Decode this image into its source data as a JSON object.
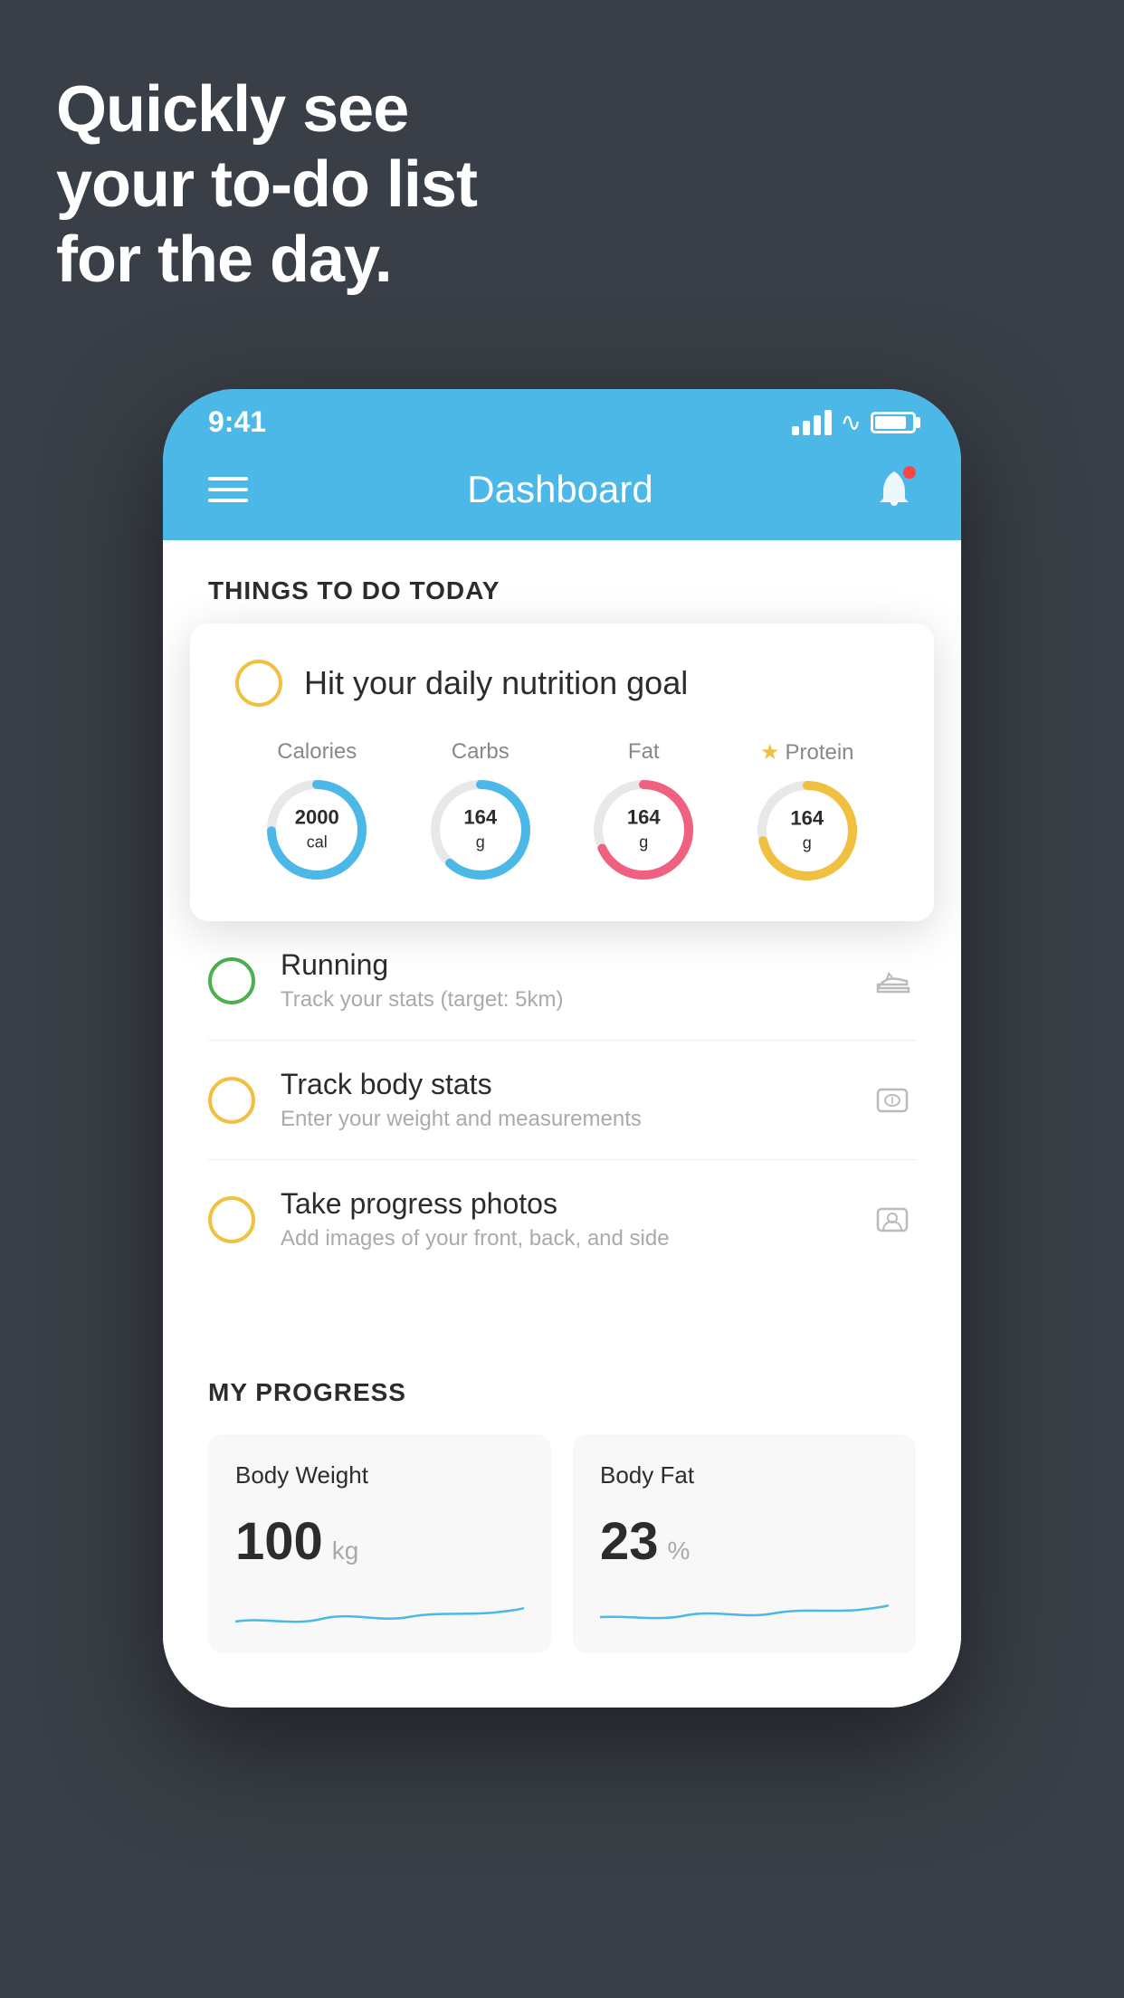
{
  "headline": {
    "line1": "Quickly see",
    "line2": "your to-do list",
    "line3": "for the day."
  },
  "status_bar": {
    "time": "9:41"
  },
  "header": {
    "title": "Dashboard"
  },
  "things_section": {
    "heading": "THINGS TO DO TODAY"
  },
  "featured_card": {
    "title": "Hit your daily nutrition goal",
    "nutrition": {
      "calories": {
        "label": "Calories",
        "value": "2000",
        "unit": "cal",
        "color": "#4bb8e8"
      },
      "carbs": {
        "label": "Carbs",
        "value": "164",
        "unit": "g",
        "color": "#4bb8e8"
      },
      "fat": {
        "label": "Fat",
        "value": "164",
        "unit": "g",
        "color": "#f06080"
      },
      "protein": {
        "label": "Protein",
        "value": "164",
        "unit": "g",
        "color": "#f0c040"
      }
    }
  },
  "todo_items": [
    {
      "name": "Running",
      "sub": "Track your stats (target: 5km)",
      "circle": "green",
      "icon": "shoe"
    },
    {
      "name": "Track body stats",
      "sub": "Enter your weight and measurements",
      "circle": "yellow",
      "icon": "scale"
    },
    {
      "name": "Take progress photos",
      "sub": "Add images of your front, back, and side",
      "circle": "yellow",
      "icon": "person"
    }
  ],
  "progress_section": {
    "heading": "MY PROGRESS",
    "cards": [
      {
        "title": "Body Weight",
        "value": "100",
        "unit": "kg"
      },
      {
        "title": "Body Fat",
        "value": "23",
        "unit": "%"
      }
    ]
  }
}
